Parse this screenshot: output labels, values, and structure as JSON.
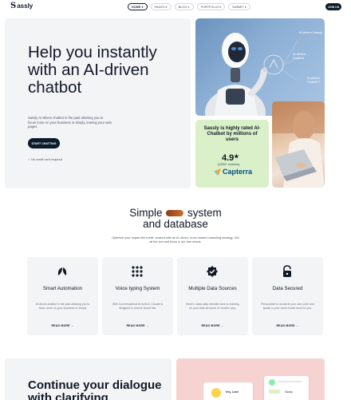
{
  "nav": {
    "logo_mark": "S",
    "logo_word": "assly",
    "items": [
      {
        "label": "HOME",
        "active": true
      },
      {
        "label": "PAGES"
      },
      {
        "label": "BLOG"
      },
      {
        "label": "PORTFOLIO"
      },
      {
        "label": "SUBMIT"
      }
    ],
    "join_label": "JOIN US"
  },
  "hero": {
    "title": "Help you instantly with an AI-driven chatbot",
    "subtitle": "Sassly AI-driven chatbot in the past allowing you to focus more on your business or simply, leaving your web pages",
    "cta_label": "START CHATTING",
    "no_card_note": "No credit card required",
    "robot_labels": [
      "AI-driven Sassly",
      "AI-driven Chatbot",
      "AI-driven ChatGPT"
    ]
  },
  "rated": {
    "text": "Sassly is highly rated AI-Chatbot by millions of users",
    "rating": "4.9",
    "reviews": "(2250+ reviews)",
    "brand": "Capterra"
  },
  "section2": {
    "title_before": "Simple",
    "title_after": "system",
    "title_line2": "and database",
    "subtitle": "Optimize your impact the bottle, season with an AI-driven, more shared marketing strategy. Get all the tool and tricks in our free ebook."
  },
  "features": [
    {
      "icon": "leaf-icon",
      "title": "Smart Automation",
      "desc": "AI-driven chatbot in the past allowing you to focus more on your business or simply",
      "more": "READ MORE"
    },
    {
      "icon": "dots-grid-icon",
      "title": "Voice typing System",
      "desc": "With Conversational AI built-in, Claude is designed to reduce brand risk.",
      "more": "READ MORE"
    },
    {
      "icon": "check-badge-icon",
      "title": "Multiple Data Sources",
      "desc": "Best in class data retention and no training on your data structure of modern way.",
      "more": "READ MORE"
    },
    {
      "icon": "lock-icon",
      "title": "Data Secured",
      "desc": "Personalize to would at your own code and speak in your voice model work for you.",
      "more": "READ MORE"
    }
  ],
  "bottom": {
    "title": "Continue your dialogue with clarifying",
    "chat_name": "Hey, Lara!",
    "chat_tag": "Sassly"
  },
  "colors": {
    "dark": "#0b1b2b",
    "hero_bg": "#f3f4f6",
    "robot_bg": "#8fb1d6",
    "rated_bg": "#d9f0c9",
    "bottom_pink": "#f6d3d0"
  }
}
